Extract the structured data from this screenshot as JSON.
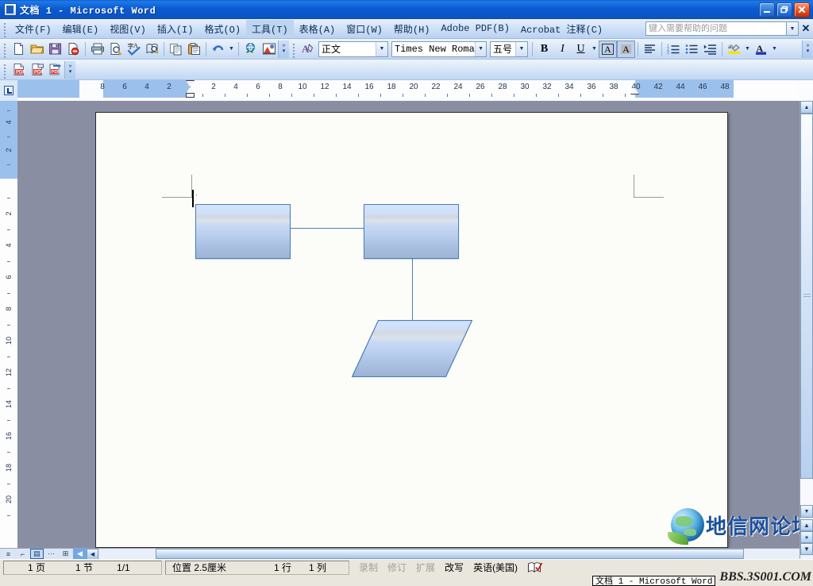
{
  "window": {
    "title": "文档 1 - Microsoft Word",
    "icon": "word-document-icon",
    "minimize_label": "_",
    "restore_label": "❐",
    "close_label": "✕"
  },
  "menu": {
    "items": [
      {
        "label": "文件(F)"
      },
      {
        "label": "编辑(E)"
      },
      {
        "label": "视图(V)"
      },
      {
        "label": "插入(I)"
      },
      {
        "label": "格式(O)"
      },
      {
        "label": "工具(T)"
      },
      {
        "label": "表格(A)"
      },
      {
        "label": "窗口(W)"
      },
      {
        "label": "帮助(H)"
      },
      {
        "label": "Adobe PDF(B)"
      },
      {
        "label": "Acrobat 注释(C)"
      }
    ],
    "help_placeholder": "键入需要帮助的问题",
    "help_value": "",
    "close_doc_label": "✕",
    "dropdown_arrow": "▼"
  },
  "standard_toolbar": {
    "buttons": [
      {
        "name": "new-document-icon",
        "title": "新建空白文档"
      },
      {
        "name": "open-folder-icon",
        "title": "打开"
      },
      {
        "name": "save-icon",
        "title": "保存"
      },
      {
        "name": "permission-icon",
        "title": "权限"
      },
      {
        "name": "print-icon",
        "title": "打印"
      },
      {
        "name": "print-preview-icon",
        "title": "打印预览"
      },
      {
        "name": "spelling-grammar-icon",
        "title": "拼写和语法"
      },
      {
        "name": "research-icon",
        "title": "信息检索"
      },
      {
        "name": "copy-icon",
        "title": "复制"
      },
      {
        "name": "paste-icon",
        "title": "粘贴"
      },
      {
        "name": "undo-icon",
        "title": "撤消"
      },
      {
        "name": "insert-hyperlink-icon",
        "title": "插入超链接"
      },
      {
        "name": "drawing-icon",
        "title": "绘图"
      }
    ],
    "overflow_label": "▾"
  },
  "formatting_toolbar": {
    "style_label": "正文",
    "font_label": "Times New Roman",
    "size_label": "五号",
    "bold_label": "B",
    "italic_label": "I",
    "underline_label": "U",
    "border_char_label": "A",
    "shading_char_label": "A",
    "align_label": "align-left-icon",
    "numbered_list_label": "numbered-list-icon",
    "bulleted_list_label": "bulleted-list-icon",
    "increase_indent_label": "increase-indent-icon",
    "highlight_label": "ab",
    "font_color_label": "A",
    "dropdown_arrow": "▼",
    "overflow_label": "▾"
  },
  "pdf_toolbar": {
    "buttons": [
      {
        "name": "convert-to-pdf-icon",
        "title": "转换为 Adobe PDF"
      },
      {
        "name": "convert-and-email-pdf-icon",
        "title": "转换为 Adobe PDF 并发送邮件"
      },
      {
        "name": "convert-and-review-pdf-icon",
        "title": "转换为 Adobe PDF 并发送以供审阅"
      }
    ],
    "overflow_label": "▾"
  },
  "ruler": {
    "tab_selector": "left-tab-stop-icon",
    "horizontal_labels": [
      "8",
      "6",
      "4",
      "2",
      "2",
      "4",
      "6",
      "8",
      "10",
      "12",
      "14",
      "16",
      "18",
      "20",
      "22",
      "24",
      "26",
      "28",
      "30",
      "32",
      "34",
      "36",
      "38",
      "40",
      "42",
      "44",
      "46",
      "48"
    ],
    "vertical_labels": [
      "4",
      "2",
      "2",
      "4",
      "6",
      "8",
      "10",
      "12",
      "14",
      "16",
      "18",
      "20"
    ],
    "unit": "字符"
  },
  "document": {
    "page_background": "#fcfdf8",
    "shapes": [
      {
        "name": "process-box-left",
        "type": "rectangle",
        "label": ""
      },
      {
        "name": "process-box-right",
        "type": "rectangle",
        "label": ""
      },
      {
        "name": "data-parallelogram",
        "type": "parallelogram",
        "label": ""
      }
    ],
    "connectors": [
      {
        "name": "connector-left-to-right",
        "type": "horizontal"
      },
      {
        "name": "connector-right-to-data",
        "type": "vertical"
      }
    ],
    "shape_fill_top": "#cfe0fa",
    "shape_fill_bottom": "#9db4d4",
    "shape_border": "#4a7ebb"
  },
  "view_buttons": [
    {
      "name": "normal-view-button",
      "glyph": "≡"
    },
    {
      "name": "web-layout-view-button",
      "glyph": "⌐"
    },
    {
      "name": "print-layout-view-button",
      "glyph": "▤",
      "selected": true
    },
    {
      "name": "outline-view-button",
      "glyph": "⋯"
    },
    {
      "name": "reading-layout-view-button",
      "glyph": "⊞"
    }
  ],
  "scrollbars": {
    "up_arrow": "▲",
    "down_arrow": "▼",
    "left_arrow": "◀",
    "right_arrow": "▶",
    "select_browse_object": "●",
    "previous_page": "▲",
    "next_page": "▼"
  },
  "statusbar": {
    "page": "1 页",
    "section": "1 节",
    "page_of": "1/1",
    "position": "位置 2.5厘米",
    "line": "1 行",
    "column": "1 列",
    "rec": "录制",
    "trk": "修订",
    "ext": "扩展",
    "ovr": "改写",
    "language": "英语(美国)",
    "spellcheck_icon": "spellcheck-book-icon"
  },
  "taskbar": {
    "window_button": "文档 1 - Microsoft Word"
  },
  "watermark": {
    "logo": "globe-leaf-logo",
    "text": "地信网论坛",
    "url": "BBS.3S001.COM"
  }
}
